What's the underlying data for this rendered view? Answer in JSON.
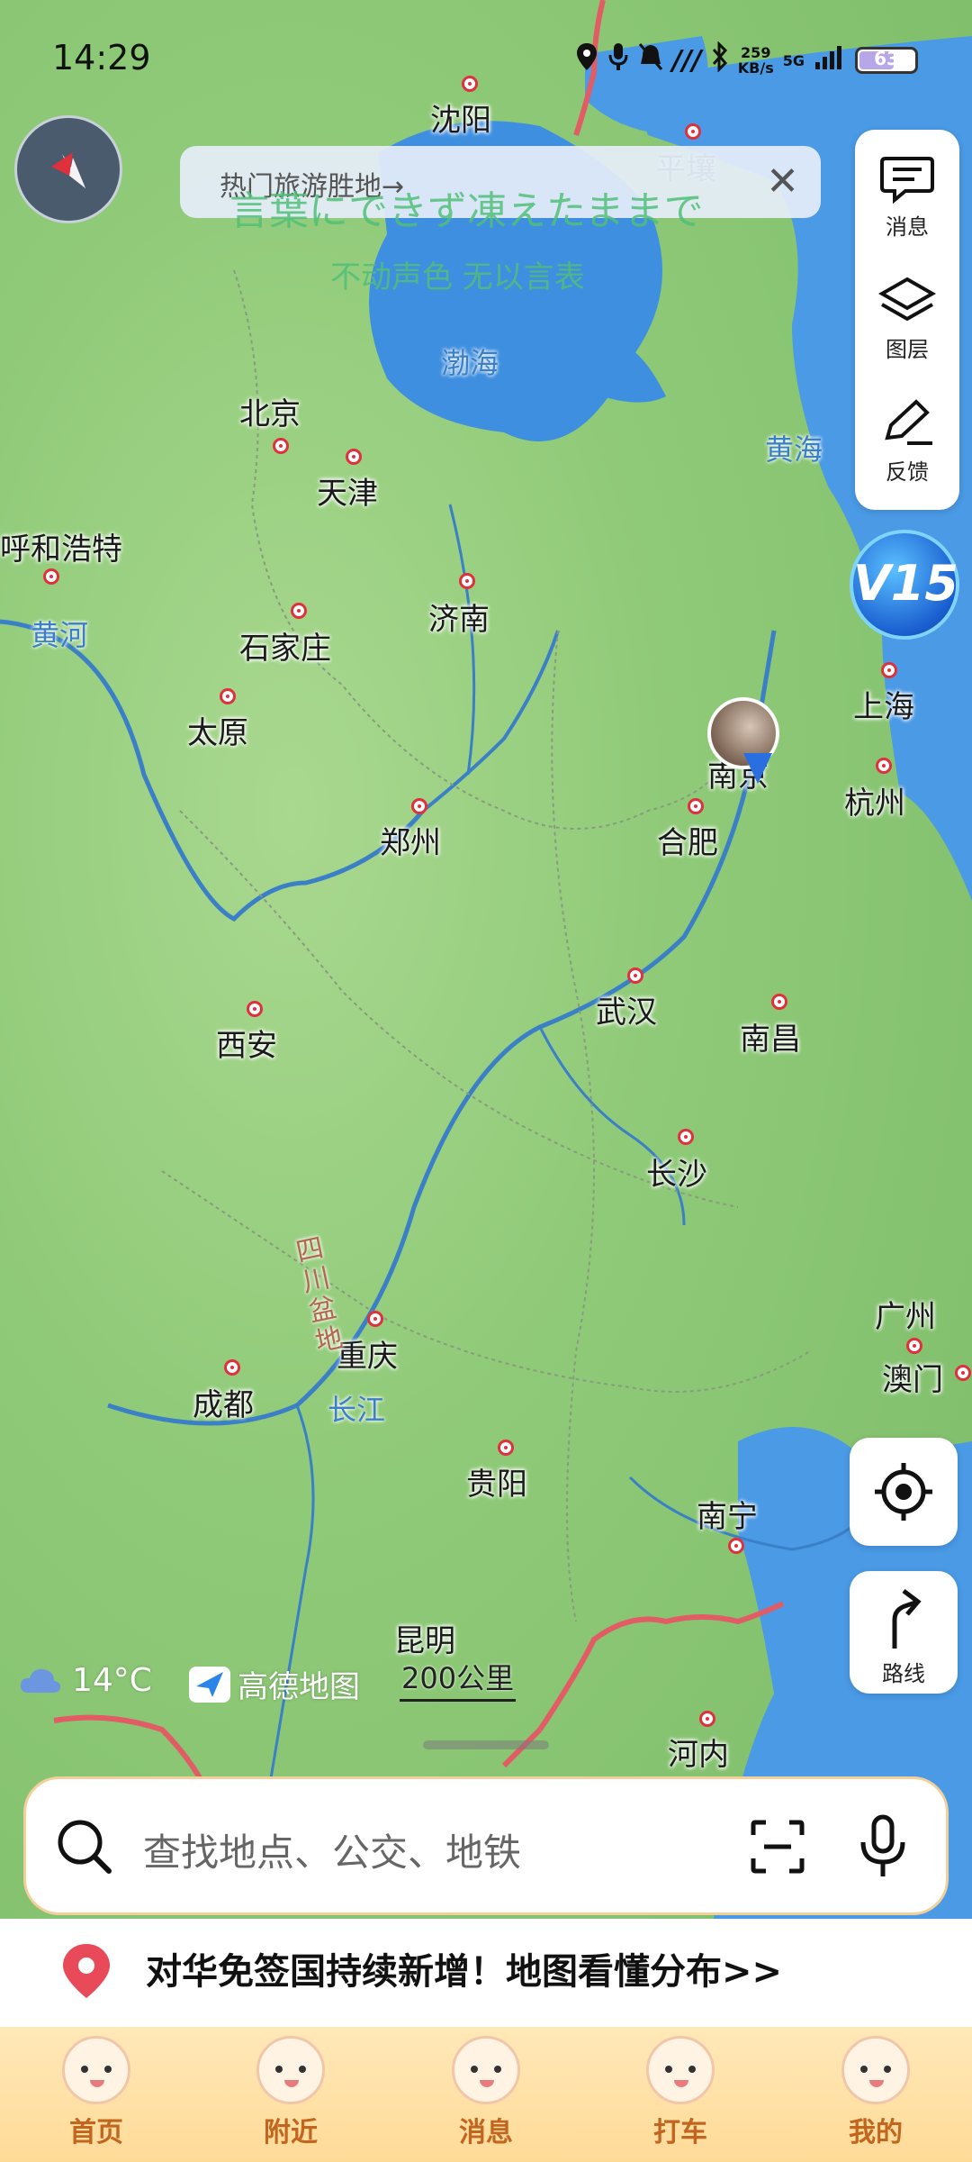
{
  "status_bar": {
    "time": "14:29",
    "net_speed_value": "259",
    "net_speed_unit": "KB/s",
    "network": "5G",
    "battery": "63"
  },
  "banner": {
    "text": "热门旅游胜地→",
    "close": "✕"
  },
  "lyrics": {
    "line1": "言葉にできず凍えたままで",
    "line2": "不动声色 无以言表"
  },
  "right_panel": {
    "messages": "消息",
    "layers": "图层",
    "feedback": "反馈"
  },
  "version_badge": "V15",
  "route_label": "路线",
  "map": {
    "cities": [
      {
        "name": "沈阳"
      },
      {
        "name": "北京"
      },
      {
        "name": "天津"
      },
      {
        "name": "呼和浩特"
      },
      {
        "name": "石家庄"
      },
      {
        "name": "济南"
      },
      {
        "name": "太原"
      },
      {
        "name": "郑州"
      },
      {
        "name": "合肥"
      },
      {
        "name": "南京"
      },
      {
        "name": "上海"
      },
      {
        "name": "杭州"
      },
      {
        "name": "西安"
      },
      {
        "name": "武汉"
      },
      {
        "name": "南昌"
      },
      {
        "name": "长沙"
      },
      {
        "name": "重庆"
      },
      {
        "name": "成都"
      },
      {
        "name": "贵阳"
      },
      {
        "name": "南宁"
      },
      {
        "name": "广州"
      },
      {
        "name": "澳门"
      },
      {
        "name": "昆明"
      },
      {
        "name": "河内"
      },
      {
        "name": "平壤"
      }
    ],
    "water_labels": {
      "bohai": "渤海",
      "huanghai": "黄海",
      "huanghe": "黄河",
      "changjiang": "长江",
      "sichuan": "四川盆地"
    }
  },
  "weather": {
    "temp": "14°C"
  },
  "brand": "高德地图",
  "scale": "200公里",
  "search": {
    "placeholder": "查找地点、公交、地铁"
  },
  "promo": {
    "text": "对华免签国持续新增！地图看懂分布>>"
  },
  "tabs": [
    {
      "label": "首页"
    },
    {
      "label": "附近"
    },
    {
      "label": "消息"
    },
    {
      "label": "打车"
    },
    {
      "label": "我的"
    }
  ],
  "colors": {
    "land": "#8fca78",
    "sea": "#3f8fe0",
    "city_ring": "#e0303c",
    "tab_text": "#c2661f",
    "search_border": "#f3cf9a"
  }
}
